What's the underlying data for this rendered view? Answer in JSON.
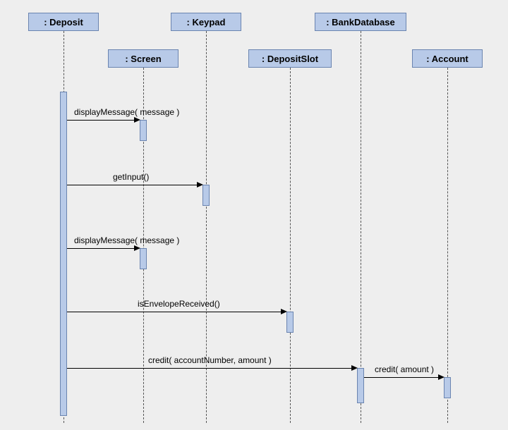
{
  "participants": {
    "deposit": {
      "label": ": Deposit"
    },
    "screen": {
      "label": ": Screen"
    },
    "keypad": {
      "label": ": Keypad"
    },
    "depositSlot": {
      "label": ": DepositSlot"
    },
    "bankDatabase": {
      "label": ": BankDatabase"
    },
    "account": {
      "label": ": Account"
    }
  },
  "messages": {
    "m1": {
      "label": "displayMessage( message )"
    },
    "m2": {
      "label": "getInput()"
    },
    "m3": {
      "label": "displayMessage( message )"
    },
    "m4": {
      "label": "isEnvelopeReceived()"
    },
    "m5": {
      "label": "credit( accountNumber, amount )"
    },
    "m6": {
      "label": "credit( amount )"
    }
  }
}
